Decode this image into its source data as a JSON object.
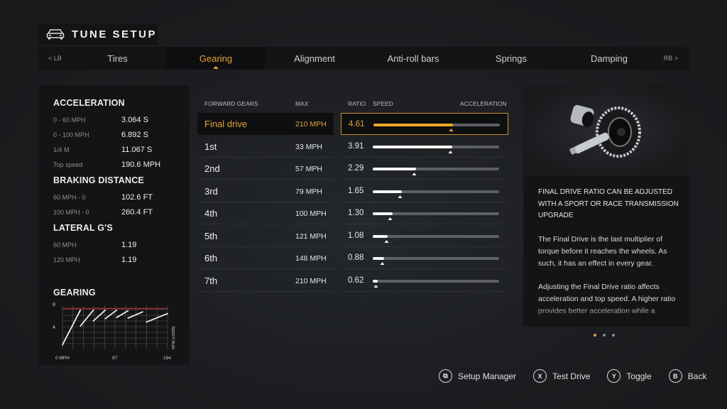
{
  "header": {
    "title": "TUNE SETUP",
    "icon": "car-icon"
  },
  "tabs": {
    "left_hint": "< LB",
    "right_hint": "RB >",
    "items": [
      {
        "label": "Tires",
        "active": false
      },
      {
        "label": "Gearing",
        "active": true
      },
      {
        "label": "Alignment",
        "active": false
      },
      {
        "label": "Anti-roll bars",
        "active": false
      },
      {
        "label": "Springs",
        "active": false
      },
      {
        "label": "Damping",
        "active": false
      }
    ]
  },
  "stats": {
    "acceleration": {
      "title": "ACCELERATION",
      "rows": [
        {
          "label": "0 - 60 MPH",
          "value": "3.064 S"
        },
        {
          "label": "0 - 100 MPH",
          "value": "6.892 S"
        },
        {
          "label": "1/4 M",
          "value": "11.067 S"
        },
        {
          "label": "Top speed",
          "value": "190.6 MPH"
        }
      ]
    },
    "braking": {
      "title": "BRAKING DISTANCE",
      "rows": [
        {
          "label": "60 MPH - 0",
          "value": "102.6 FT"
        },
        {
          "label": "100 MPH - 0",
          "value": "260.4 FT"
        }
      ]
    },
    "lateral": {
      "title": "LATERAL G'S",
      "rows": [
        {
          "label": "60 MPH",
          "value": "1.19"
        },
        {
          "label": "120 MPH",
          "value": "1.19"
        }
      ]
    },
    "gearing": {
      "title": "GEARING"
    }
  },
  "chart_data": {
    "type": "line",
    "title": "GEARING",
    "xlabel": "MPH",
    "ylabel": "RPM (x1000)",
    "x_ticks": [
      "0 MPH",
      "97",
      "194"
    ],
    "y_ticks": [
      "8",
      "4"
    ],
    "xlim": [
      0,
      194
    ],
    "ylim": [
      0,
      8
    ],
    "redline": 7.2,
    "grid": true,
    "series": [
      {
        "name": "1st",
        "points": [
          [
            0,
            0.8
          ],
          [
            33,
            6.9
          ]
        ]
      },
      {
        "name": "2nd",
        "points": [
          [
            33,
            4.1
          ],
          [
            57,
            6.9
          ]
        ]
      },
      {
        "name": "3rd",
        "points": [
          [
            57,
            5.0
          ],
          [
            79,
            6.9
          ]
        ]
      },
      {
        "name": "4th",
        "points": [
          [
            79,
            5.4
          ],
          [
            100,
            6.9
          ]
        ]
      },
      {
        "name": "5th",
        "points": [
          [
            100,
            5.6
          ],
          [
            121,
            6.8
          ]
        ]
      },
      {
        "name": "6th",
        "points": [
          [
            121,
            5.5
          ],
          [
            148,
            6.6
          ]
        ]
      },
      {
        "name": "7th",
        "points": [
          [
            155,
            4.8
          ],
          [
            194,
            6.3
          ]
        ]
      }
    ]
  },
  "gear_table": {
    "headers": {
      "gears": "FORWARD GEARS",
      "max": "MAX",
      "ratio": "RATIO",
      "speed": "SPEED",
      "accel": "ACCELERATION"
    },
    "rows": [
      {
        "name": "Final drive",
        "max": "210 MPH",
        "ratio": "4.61",
        "speed_pct": 63,
        "accel_pct": 62,
        "selected": true
      },
      {
        "name": "1st",
        "max": "33 MPH",
        "ratio": "3.91",
        "speed_pct": 63,
        "accel_pct": 62,
        "selected": false
      },
      {
        "name": "2nd",
        "max": "57 MPH",
        "ratio": "2.29",
        "speed_pct": 34,
        "accel_pct": 33,
        "selected": false
      },
      {
        "name": "3rd",
        "max": "79 MPH",
        "ratio": "1.65",
        "speed_pct": 23,
        "accel_pct": 22,
        "selected": false
      },
      {
        "name": "4th",
        "max": "100 MPH",
        "ratio": "1.30",
        "speed_pct": 16,
        "accel_pct": 14,
        "selected": false
      },
      {
        "name": "5th",
        "max": "121 MPH",
        "ratio": "1.08",
        "speed_pct": 12,
        "accel_pct": 11,
        "selected": false
      },
      {
        "name": "6th",
        "max": "148 MPH",
        "ratio": "0.88",
        "speed_pct": 9,
        "accel_pct": 8,
        "selected": false
      },
      {
        "name": "7th",
        "max": "210 MPH",
        "ratio": "0.62",
        "speed_pct": 4,
        "accel_pct": 3,
        "selected": false
      }
    ]
  },
  "info": {
    "image": "differential-gear-image",
    "heading": "FINAL DRIVE RATIO CAN BE ADJUSTED WITH A SPORT OR RACE TRANSMISSION UPGRADE",
    "paragraphs": [
      "The Final Drive is the last multiplier of torque before it reaches the wheels. As such, it has an effect in every gear.",
      "Adjusting the Final Drive ratio affects acceleration and top speed. A higher ratio provides better acceleration while a"
    ],
    "page_count": 3,
    "active_page": 1
  },
  "footer": [
    {
      "icon": "view-button-icon",
      "glyph": "⧉",
      "label": "Setup Manager"
    },
    {
      "icon": "x-button-icon",
      "glyph": "X",
      "label": "Test Drive"
    },
    {
      "icon": "y-button-icon",
      "glyph": "Y",
      "label": "Toggle"
    },
    {
      "icon": "b-button-icon",
      "glyph": "B",
      "label": "Back"
    }
  ],
  "colors": {
    "accent": "#e3a43a",
    "panel": "#141416",
    "redline": "#b0302c"
  }
}
